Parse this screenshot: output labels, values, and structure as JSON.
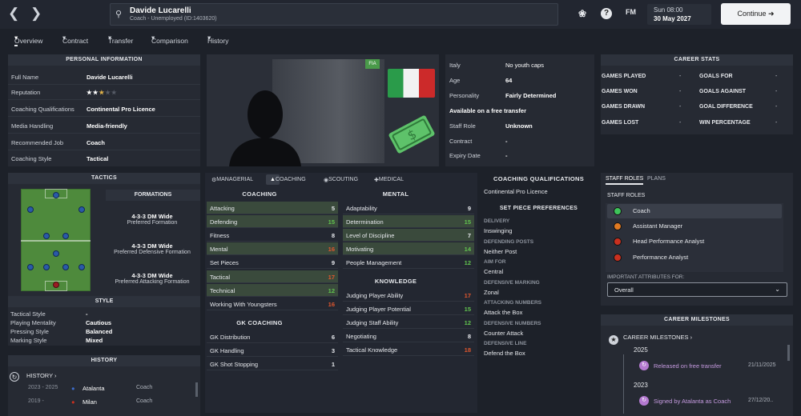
{
  "header": {
    "name": "Davide Lucarelli",
    "subtitle": "Coach - Unemployed (ID:1403620)",
    "fm_label": "FM",
    "day_time": "Sun 08:00",
    "date": "30 May 2027",
    "continue_label": "Continue"
  },
  "subnav": [
    "Overview",
    "Contract",
    "Transfer",
    "Comparison",
    "History"
  ],
  "personal": {
    "title": "PERSONAL INFORMATION",
    "rows": [
      {
        "k": "Full Name",
        "v": "Davide Lucarelli"
      },
      {
        "k": "Reputation",
        "v": ""
      },
      {
        "k": "Coaching Qualifications",
        "v": "Continental Pro Licence"
      },
      {
        "k": "Media Handling",
        "v": "Media-friendly"
      },
      {
        "k": "Recommended Job",
        "v": "Coach"
      },
      {
        "k": "Coaching Style",
        "v": "Tactical"
      }
    ],
    "reputation_stars": 2.5
  },
  "tactics": {
    "title": "TACTICS",
    "formations_title": "FORMATIONS",
    "formations": [
      {
        "name": "4-3-3 DM Wide",
        "desc": "Preferred Formation"
      },
      {
        "name": "4-3-3 DM Wide",
        "desc": "Preferred Defensive Formation"
      },
      {
        "name": "4-3-3 DM Wide",
        "desc": "Preferred Attacking Formation"
      }
    ],
    "style_title": "STYLE",
    "style": [
      {
        "k": "Tactical Style",
        "v": "-"
      },
      {
        "k": "Playing Mentality",
        "v": "Cautious"
      },
      {
        "k": "Pressing Style",
        "v": "Balanced"
      },
      {
        "k": "Marking Style",
        "v": "Mixed"
      }
    ]
  },
  "history": {
    "title": "HISTORY",
    "link": "HISTORY",
    "rows": [
      {
        "years": "2023 - 2025",
        "club": "Atalanta",
        "role": "Coach"
      },
      {
        "years": "2019 -",
        "club": "Milan",
        "role": "Coach"
      }
    ]
  },
  "profile": {
    "fa_badge": "FIA",
    "nation": "Italy",
    "youth_caps": "No youth caps",
    "age_k": "Age",
    "age_v": "64",
    "personality_k": "Personality",
    "personality_v": "Fairly Determined",
    "transfer_status": "Available on a free transfer",
    "staff_role_k": "Staff Role",
    "staff_role_v": "Unknown",
    "contract_k": "Contract",
    "contract_v": "-",
    "expiry_k": "Expiry Date",
    "expiry_v": "-"
  },
  "attr_tabs": [
    "MANAGERIAL",
    "COACHING",
    "SCOUTING",
    "MEDICAL"
  ],
  "coaching": {
    "title": "COACHING",
    "items": [
      {
        "n": "Attacking",
        "v": "5",
        "hl": true
      },
      {
        "n": "Defending",
        "v": "15",
        "hl": true
      },
      {
        "n": "Fitness",
        "v": "8",
        "hl": false
      },
      {
        "n": "Mental",
        "v": "16",
        "hl": true
      },
      {
        "n": "Set Pieces",
        "v": "9",
        "hl": false
      },
      {
        "n": "Tactical",
        "v": "17",
        "hl": true
      },
      {
        "n": "Technical",
        "v": "12",
        "hl": true
      },
      {
        "n": "Working With Youngsters",
        "v": "16",
        "hl": false
      }
    ]
  },
  "gk_coaching": {
    "title": "GK COACHING",
    "items": [
      {
        "n": "GK Distribution",
        "v": "6"
      },
      {
        "n": "GK Handling",
        "v": "3"
      },
      {
        "n": "GK Shot Stopping",
        "v": "1"
      }
    ]
  },
  "mental": {
    "title": "MENTAL",
    "items": [
      {
        "n": "Adaptability",
        "v": "9",
        "hl": false
      },
      {
        "n": "Determination",
        "v": "15",
        "hl": true
      },
      {
        "n": "Level of Discipline",
        "v": "7",
        "hl": true
      },
      {
        "n": "Motivating",
        "v": "14",
        "hl": true
      },
      {
        "n": "People Management",
        "v": "12",
        "hl": false
      }
    ]
  },
  "knowledge": {
    "title": "KNOWLEDGE",
    "items": [
      {
        "n": "Judging Player Ability",
        "v": "17"
      },
      {
        "n": "Judging Player Potential",
        "v": "15"
      },
      {
        "n": "Judging Staff Ability",
        "v": "12"
      },
      {
        "n": "Negotiating",
        "v": "8"
      },
      {
        "n": "Tactical Knowledge",
        "v": "18"
      }
    ]
  },
  "qualifications": {
    "title": "COACHING QUALIFICATIONS",
    "value": "Continental Pro Licence",
    "sp_title": "SET PIECE PREFERENCES",
    "sp": [
      {
        "k": "DELIVERY",
        "v": "Inswinging"
      },
      {
        "k": "DEFENDING POSTS",
        "v": "Neither Post"
      },
      {
        "k": "AIM FOR",
        "v": "Central"
      },
      {
        "k": "DEFENSIVE MARKING",
        "v": "Zonal"
      },
      {
        "k": "ATTACKING NUMBERS",
        "v": "Attack the Box"
      },
      {
        "k": "DEFENSIVE NUMBERS",
        "v": "Counter Attack"
      },
      {
        "k": "DEFENSIVE LINE",
        "v": "Defend the Box"
      }
    ]
  },
  "career_stats": {
    "title": "CAREER STATS",
    "left": [
      {
        "k": "GAMES PLAYED",
        "v": "-"
      },
      {
        "k": "GAMES WON",
        "v": "-"
      },
      {
        "k": "GAMES DRAWN",
        "v": "-"
      },
      {
        "k": "GAMES LOST",
        "v": "-"
      }
    ],
    "right": [
      {
        "k": "GOALS FOR",
        "v": "-"
      },
      {
        "k": "GOALS AGAINST",
        "v": "-"
      },
      {
        "k": "GOAL DIFFERENCE",
        "v": "-"
      },
      {
        "k": "WIN PERCENTAGE",
        "v": "-"
      }
    ]
  },
  "staff_roles": {
    "tab1": "STAFF ROLES",
    "tab2": "PLANS",
    "title": "STAFF ROLES",
    "roles": [
      {
        "n": "Coach",
        "color": "#3ec45a"
      },
      {
        "n": "Assistant Manager",
        "color": "#e07a22"
      },
      {
        "n": "Head Performance Analyst",
        "color": "#c9301f"
      },
      {
        "n": "Performance Analyst",
        "color": "#c9301f"
      }
    ],
    "important_label": "IMPORTANT ATTRIBUTES FOR:",
    "select_value": "Overall"
  },
  "milestones": {
    "title": "CAREER MILESTONES",
    "link": "CAREER MILESTONES",
    "items": [
      {
        "year": "2025",
        "text": "Released on free transfer",
        "date": "21/11/2025"
      },
      {
        "year": "2023",
        "text": "Signed by Atalanta as Coach",
        "date": "27/12/20.."
      }
    ]
  },
  "colors": {
    "accent": "#9ad08a",
    "high": "#e0572e",
    "mid": "#62c44f",
    "low": "#e6e8ec"
  }
}
